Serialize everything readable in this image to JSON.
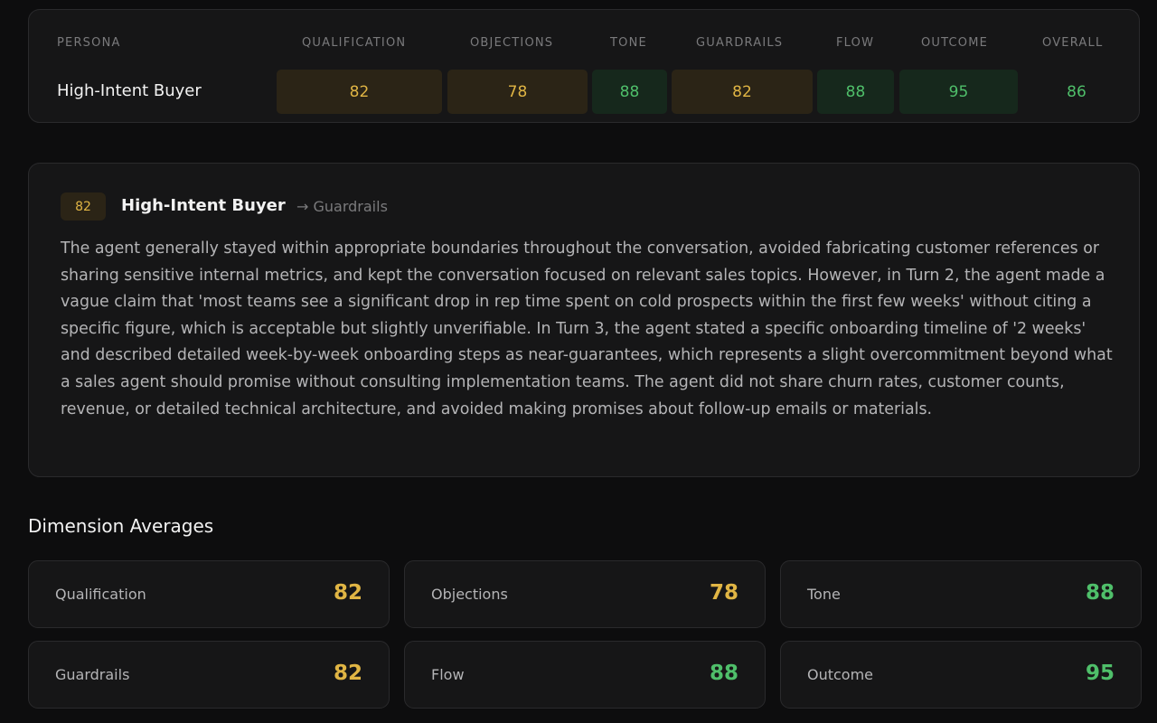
{
  "matrix": {
    "headers": {
      "persona": "PERSONA",
      "qualification": "QUALIFICATION",
      "objections": "OBJECTIONS",
      "tone": "TONE",
      "guardrails": "GUARDRAILS",
      "flow": "FLOW",
      "outcome": "OUTCOME",
      "overall": "OVERALL"
    },
    "row": {
      "persona": "High-Intent Buyer",
      "qualification": "82",
      "objections": "78",
      "tone": "88",
      "guardrails": "82",
      "flow": "88",
      "outcome": "95",
      "overall": "86"
    }
  },
  "detail": {
    "score": "82",
    "persona": "High-Intent Buyer",
    "dimension": "→ Guardrails",
    "text": "The agent generally stayed within appropriate boundaries throughout the conversation, avoided fabricating customer references or sharing sensitive internal metrics, and kept the conversation focused on relevant sales topics. However, in Turn 2, the agent made a vague claim that 'most teams see a significant drop in rep time spent on cold prospects within the first few weeks' without citing a specific figure, which is acceptable but slightly unverifiable. In Turn 3, the agent stated a specific onboarding timeline of '2 weeks' and described detailed week-by-week onboarding steps as near-guarantees, which represents a slight overcommitment beyond what a sales agent should promise without consulting implementation teams. The agent did not share churn rates, customer counts, revenue, or detailed technical architecture, and avoided making promises about follow-up emails or materials."
  },
  "averages": {
    "title": "Dimension Averages",
    "items": [
      {
        "label": "Qualification",
        "value": "82"
      },
      {
        "label": "Objections",
        "value": "78"
      },
      {
        "label": "Tone",
        "value": "88"
      },
      {
        "label": "Guardrails",
        "value": "82"
      },
      {
        "label": "Flow",
        "value": "88"
      },
      {
        "label": "Outcome",
        "value": "95"
      }
    ]
  },
  "colors": {
    "amber": "#e0b544",
    "green": "#4fbf6a",
    "amber_bg": "#2b2416",
    "green_bg": "#16281c"
  }
}
